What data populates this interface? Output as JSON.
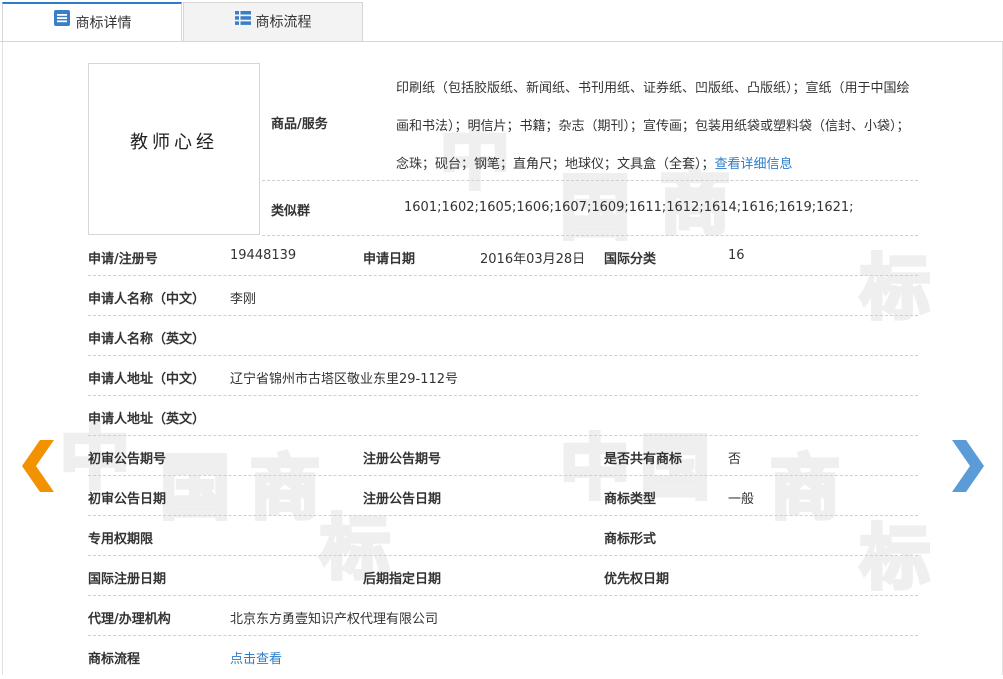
{
  "tabs": [
    {
      "label": "商标详情",
      "active": true
    },
    {
      "label": "商标流程",
      "active": false
    }
  ],
  "goods": {
    "label": "商品/服务",
    "text": "印刷纸（包括胶版纸、新闻纸、书刊用纸、证券纸、凹版纸、凸版纸）；宣纸（用于中国绘画和书法）；明信片；书籍；杂志（期刊）；宣传画；包装用纸袋或塑料袋（信封、小袋）；念珠；砚台；钢笔；直角尺；地球仪；文具盒（全套）；",
    "detail_link": "查看详细信息"
  },
  "similar": {
    "label": "类似群",
    "value": "1601;1602;1605;1606;1607;1609;1611;1612;1614;1616;1619;1621;"
  },
  "reg_no": {
    "label": "申请/注册号",
    "value": "19448139"
  },
  "apply_date": {
    "label": "申请日期",
    "value": "2016年03月28日"
  },
  "intl_class": {
    "label": "国际分类",
    "value": "16"
  },
  "applicant_cn": {
    "label": "申请人名称（中文）",
    "value": "李刚"
  },
  "applicant_en": {
    "label": "申请人名称（英文）",
    "value": ""
  },
  "address_cn": {
    "label": "申请人地址（中文）",
    "value": "辽宁省锦州市古塔区敬业东里29-112号"
  },
  "address_en": {
    "label": "申请人地址（英文）",
    "value": ""
  },
  "prelim_no": {
    "label": "初审公告期号",
    "value": ""
  },
  "reg_pub_no": {
    "label": "注册公告期号",
    "value": ""
  },
  "shared": {
    "label": "是否共有商标",
    "value": "否"
  },
  "prelim_date": {
    "label": "初审公告日期",
    "value": ""
  },
  "reg_pub_date": {
    "label": "注册公告日期",
    "value": ""
  },
  "tm_type": {
    "label": "商标类型",
    "value": "一般"
  },
  "exclusive_term": {
    "label": "专用权期限",
    "value": ""
  },
  "tm_form": {
    "label": "商标形式",
    "value": ""
  },
  "intl_reg_date": {
    "label": "国际注册日期",
    "value": ""
  },
  "later_date": {
    "label": "后期指定日期",
    "value": ""
  },
  "priority_date": {
    "label": "优先权日期",
    "value": ""
  },
  "agent": {
    "label": "代理/办理机构",
    "value": "北京东方勇壹知识产权代理有限公司"
  },
  "flow": {
    "label": "商标流程",
    "link": "点击查看"
  },
  "trademark_image": {
    "text": "教师心经"
  },
  "watermark": {
    "chars": [
      "中",
      "国",
      "商",
      "标"
    ]
  },
  "colors": {
    "accent": "#2d7dc9",
    "prev_arrow": "#f39200",
    "next_arrow": "#5a9bd8"
  }
}
